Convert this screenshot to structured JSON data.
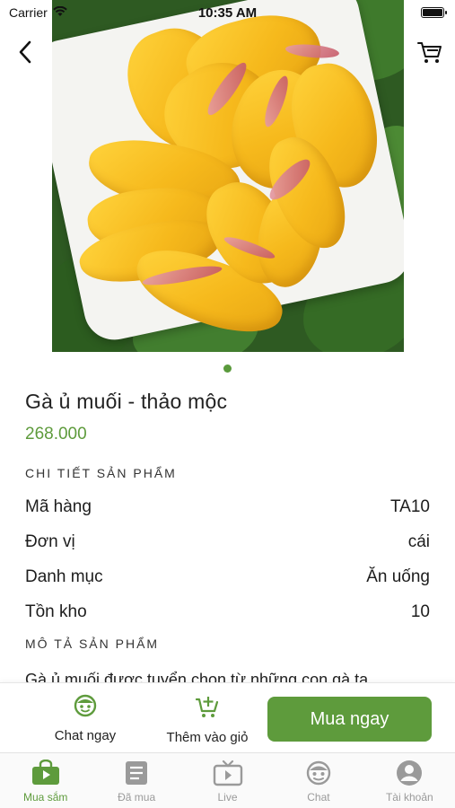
{
  "status_bar": {
    "carrier": "Carrier",
    "time": "10:35 AM"
  },
  "header": {
    "back_icon": "chevron-left-icon",
    "cart_icon": "cart-icon"
  },
  "gallery": {
    "image_count": 1,
    "active_index": 0
  },
  "product": {
    "name": "Gà ủ muối - thảo mộc",
    "price": "268.000",
    "details_title": "CHI TIẾT SẢN PHẨM",
    "details": [
      {
        "label": "Mã hàng",
        "value": "TA10"
      },
      {
        "label": "Đơn vị",
        "value": "cái"
      },
      {
        "label": "Danh mục",
        "value": "Ăn uống"
      },
      {
        "label": "Tồn kho",
        "value": "10"
      }
    ],
    "description_title": "MÔ TẢ SẢN PHẨM",
    "description": "Gà ủ muối được tuyển chọn từ những con gà ta"
  },
  "actions": {
    "chat_label": "Chat ngay",
    "add_to_cart_label": "Thêm vào giỏ",
    "buy_label": "Mua ngay"
  },
  "tabs": [
    {
      "label": "Mua sắm",
      "icon": "shopping-icon",
      "active": true
    },
    {
      "label": "Đã mua",
      "icon": "document-icon",
      "active": false
    },
    {
      "label": "Live",
      "icon": "tv-icon",
      "active": false
    },
    {
      "label": "Chat",
      "icon": "chat-face-icon",
      "active": false
    },
    {
      "label": "Tài khoản",
      "icon": "account-icon",
      "active": false
    }
  ],
  "colors": {
    "accent": "#5e9b3c",
    "inactive_tab": "#9a9a9a"
  }
}
